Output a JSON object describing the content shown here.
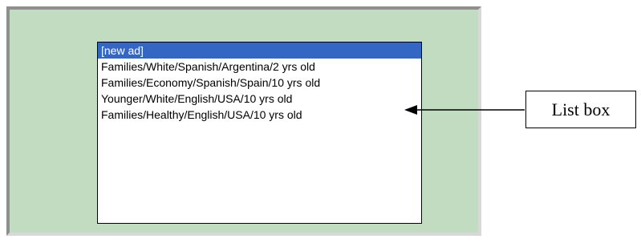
{
  "listbox": {
    "items": [
      {
        "label": "[new ad]",
        "selected": true
      },
      {
        "label": "Families/White/Spanish/Argentina/2 yrs old",
        "selected": false
      },
      {
        "label": "Families/Economy/Spanish/Spain/10 yrs old",
        "selected": false
      },
      {
        "label": "Younger/White/English/USA/10 yrs old",
        "selected": false
      },
      {
        "label": "Families/Healthy/English/USA/10 yrs old",
        "selected": false
      }
    ],
    "selected_color": "#3467c4"
  },
  "panel": {
    "background_color": "#c2dcc2"
  },
  "callout": {
    "label": "List box",
    "arrow_icon": "left-arrow-icon"
  }
}
